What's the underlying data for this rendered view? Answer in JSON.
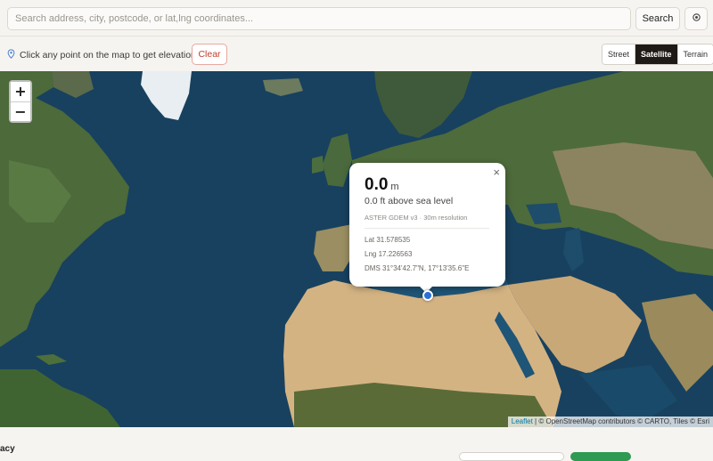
{
  "search": {
    "placeholder": "Search address, city, postcode, or lat,lng coordinates...",
    "value": "",
    "button_label": "Search",
    "locate_icon": "crosshair-icon"
  },
  "toolbar": {
    "hint_icon": "map-pin-icon",
    "hint": "Click any point on the map to get elevation",
    "clear_label": "Clear",
    "layers": [
      {
        "label": "Street",
        "active": false
      },
      {
        "label": "Satellite",
        "active": true
      },
      {
        "label": "Terrain",
        "active": false
      }
    ]
  },
  "map": {
    "zoom_in": "+",
    "zoom_out": "−",
    "popup": {
      "close": "×",
      "elevation_value": "0.0",
      "elevation_unit": "m",
      "feet": "0.0 ft above sea level",
      "source": "ASTER GDEM v3 · 30m resolution",
      "lat": "Lat 31.578535",
      "lng": "Lng 17.226563",
      "dms": "DMS 31°34'42.7\"N, 17°13'35.6\"E"
    },
    "attribution": {
      "leaflet": "Leaflet",
      "text": " | © OpenStreetMap contributors © CARTO, Tiles © Esri"
    }
  },
  "footer": {
    "text": "acy"
  }
}
